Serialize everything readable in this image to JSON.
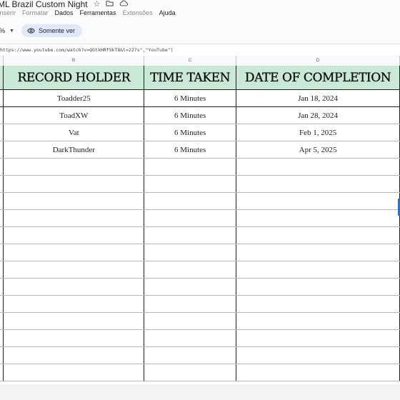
{
  "app": {
    "title": "ML Brazil Custom Night",
    "title_icons": [
      "star-icon",
      "move-to-folder-icon",
      "cloud-status-icon"
    ]
  },
  "menu": [
    "Inserir",
    "Formatar",
    "Dados",
    "Ferramentas",
    "Extensões",
    "Ajuda"
  ],
  "menu_disabled": [
    true,
    true,
    false,
    false,
    true,
    false
  ],
  "toolbar": {
    "zoom": "%",
    "mode_label": "Somente ver",
    "mode_icon": "eye-icon"
  },
  "formula_bar": {
    "value": "https://www.youtube.com/watch?v=QGtkHRf5kT8&t=227s\",\"YouTube\")"
  },
  "columns": [
    "B",
    "C",
    "D"
  ],
  "table": {
    "headers": [
      "RECORD HOLDER",
      "TIME TAKEN",
      "DATE OF COMPLETION"
    ],
    "rows": [
      [
        "Toadder25",
        "6 Minutes",
        "Jan 18, 2024"
      ],
      [
        "ToadXW",
        "6 Minutes",
        "Jan 28, 2024"
      ],
      [
        "Vat",
        "6 Minutes",
        "Feb 1, 2025"
      ],
      [
        "DarkThunder",
        "6 Minutes",
        "Apr 5, 2025"
      ]
    ],
    "empty_rows": 13
  },
  "colors": {
    "header_fill": "#c9e8d6",
    "chip_fill": "#dfe9f7",
    "selection": "#1a73e8"
  }
}
